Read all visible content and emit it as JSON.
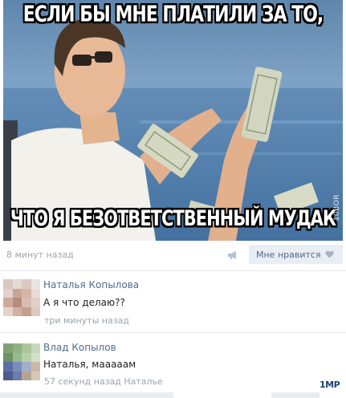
{
  "meme": {
    "top_caption": "ЕСЛИ БЫ МНЕ ПЛАТИЛИ ЗА ТО,",
    "bottom_caption": "ЧТО Я БЕЗОТВЕТСТВЕННЫЙ МУДАК",
    "watermark": "10BOR"
  },
  "post": {
    "time": "8 минут назад",
    "like_label": "Мне нравится",
    "share_icon": "megaphone-icon",
    "like_icon": "heart-icon"
  },
  "comments": [
    {
      "author": "Наталья Копылова",
      "text": "А я что делаю??",
      "time": "три минуты назад"
    },
    {
      "author": "Влад Копылов",
      "text": "Наталья, мааааам",
      "time": "57 секунд назад Наталье"
    }
  ],
  "logo": "1MP",
  "colors": {
    "link": "#4f6c92",
    "muted": "#9aa3ad",
    "like_bg": "#e9eef4"
  }
}
